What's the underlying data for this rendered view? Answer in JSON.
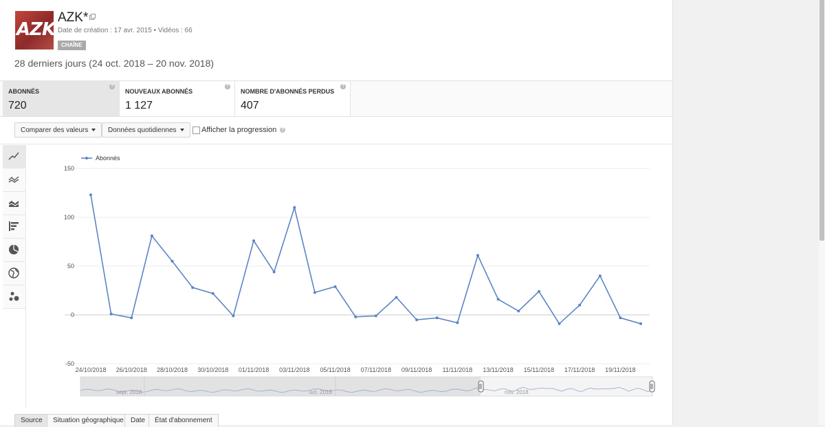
{
  "channel": {
    "name": "AZK*",
    "avatar_text": "AZK",
    "meta": "Date de création : 17 avr. 2015  •  Vidéos : 66",
    "badge": "CHAÎNE"
  },
  "date_range": "28 derniers jours (24 oct. 2018 – 20 nov. 2018)",
  "metrics": [
    {
      "label": "ABONNÉS",
      "value": "720",
      "active": true
    },
    {
      "label": "NOUVEAUX ABONNÉS",
      "value": "1 127",
      "active": false
    },
    {
      "label": "NOMBRE D'ABONNÉS PERDUS",
      "value": "407",
      "active": false
    }
  ],
  "toolbar": {
    "compare_label": "Comparer des valeurs",
    "granularity_label": "Données quotidiennes",
    "progress_label": "Afficher la progression",
    "progress_checked": false
  },
  "chart_type_icons": [
    "line-chart-icon",
    "multi-line-icon",
    "stacked-area-icon",
    "bar-chart-icon",
    "pie-chart-icon",
    "globe-icon",
    "bubble-chart-icon"
  ],
  "chart_data": {
    "type": "line",
    "series": [
      {
        "name": "Abonnés",
        "color": "#5b84c4",
        "values": [
          123,
          1,
          -3,
          81,
          55,
          28,
          22,
          -1,
          76,
          44,
          110,
          23,
          29,
          -2,
          -1,
          18,
          -5,
          -3,
          -8,
          61,
          16,
          4,
          24,
          -9,
          10,
          40,
          -3,
          -9
        ]
      }
    ],
    "x_tick_labels": [
      "24/10/2018",
      "26/10/2018",
      "28/10/2018",
      "30/10/2018",
      "01/11/2018",
      "03/11/2018",
      "05/11/2018",
      "07/11/2018",
      "09/11/2018",
      "11/11/2018",
      "13/11/2018",
      "15/11/2018",
      "17/11/2018",
      "19/11/2018"
    ],
    "y_ticks": [
      150,
      100,
      50,
      0,
      -50
    ],
    "ylim": [
      -50,
      150
    ],
    "legend": "top-left",
    "grid": true
  },
  "navigator": {
    "labels": [
      "sept. 2018",
      "oct. 2018",
      "nov. 2018"
    ]
  },
  "bottom_tabs": [
    "Source",
    "Situation géographique",
    "Date",
    "État d'abonnement"
  ]
}
